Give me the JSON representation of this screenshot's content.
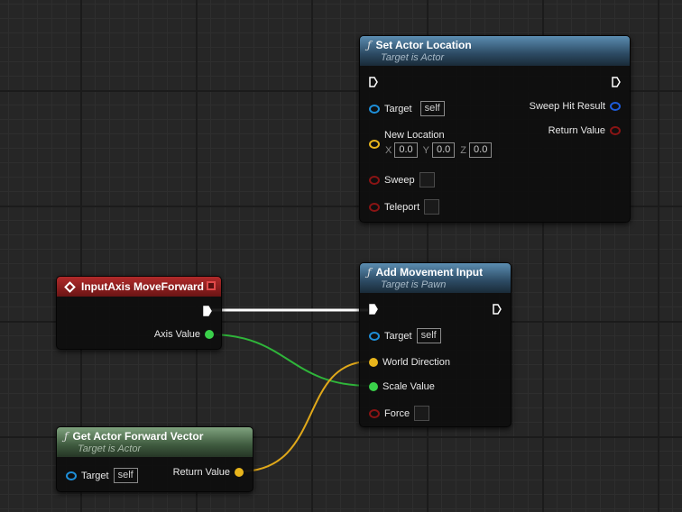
{
  "colors": {
    "exec_pin": "#ffffff",
    "object_pin": "#1e8fd9",
    "vector_pin": "#e8b51c",
    "float_pin": "#3ad04a",
    "bool_pin": "#8a1414",
    "hit_result_pin": "#1e5bd9",
    "function_header": "#2c4a63",
    "pure_header": "#3e5a3e",
    "event_header": "#8a1c1c"
  },
  "nodes": {
    "set_actor_location": {
      "title": "Set Actor Location",
      "subtitle": "Target is Actor",
      "target_label": "Target",
      "target_value": "self",
      "new_location_label": "New Location",
      "x_label": "X",
      "x_value": "0.0",
      "y_label": "Y",
      "y_value": "0.0",
      "z_label": "Z",
      "z_value": "0.0",
      "sweep_label": "Sweep",
      "teleport_label": "Teleport",
      "sweep_hit_result_label": "Sweep Hit Result",
      "return_value_label": "Return Value"
    },
    "input_axis": {
      "title": "InputAxis MoveForward",
      "axis_value_label": "Axis Value"
    },
    "add_movement_input": {
      "title": "Add Movement Input",
      "subtitle": "Target is Pawn",
      "target_label": "Target",
      "target_value": "self",
      "world_direction_label": "World Direction",
      "scale_value_label": "Scale Value",
      "force_label": "Force"
    },
    "get_forward_vector": {
      "title": "Get Actor Forward Vector",
      "subtitle": "Target is Actor",
      "target_label": "Target",
      "target_value": "self",
      "return_value_label": "Return Value"
    }
  }
}
